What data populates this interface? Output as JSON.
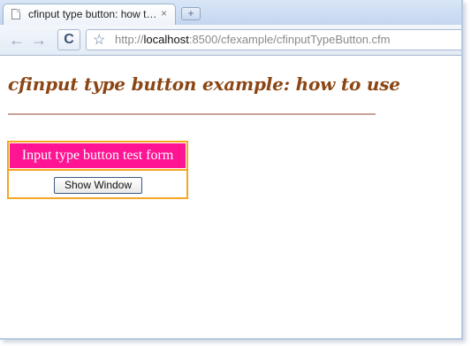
{
  "browser": {
    "tab_title": "cfinput type button: how t…",
    "tab_close_icon": "×",
    "new_tab_icon": "+",
    "back_icon": "←",
    "forward_icon": "→",
    "reload_icon": "C",
    "star_icon": "☆",
    "url_scheme": "http://",
    "url_host": "localhost",
    "url_rest": ":8500/cfexample/cfinputTypeButton.cfm"
  },
  "page": {
    "title": "cfinput type button example: how to use",
    "form_header": "Input type button test form",
    "button_label": "Show Window",
    "title_color": "#8b4513",
    "header_bg": "#ff1493",
    "border_color": "#f5a623"
  }
}
